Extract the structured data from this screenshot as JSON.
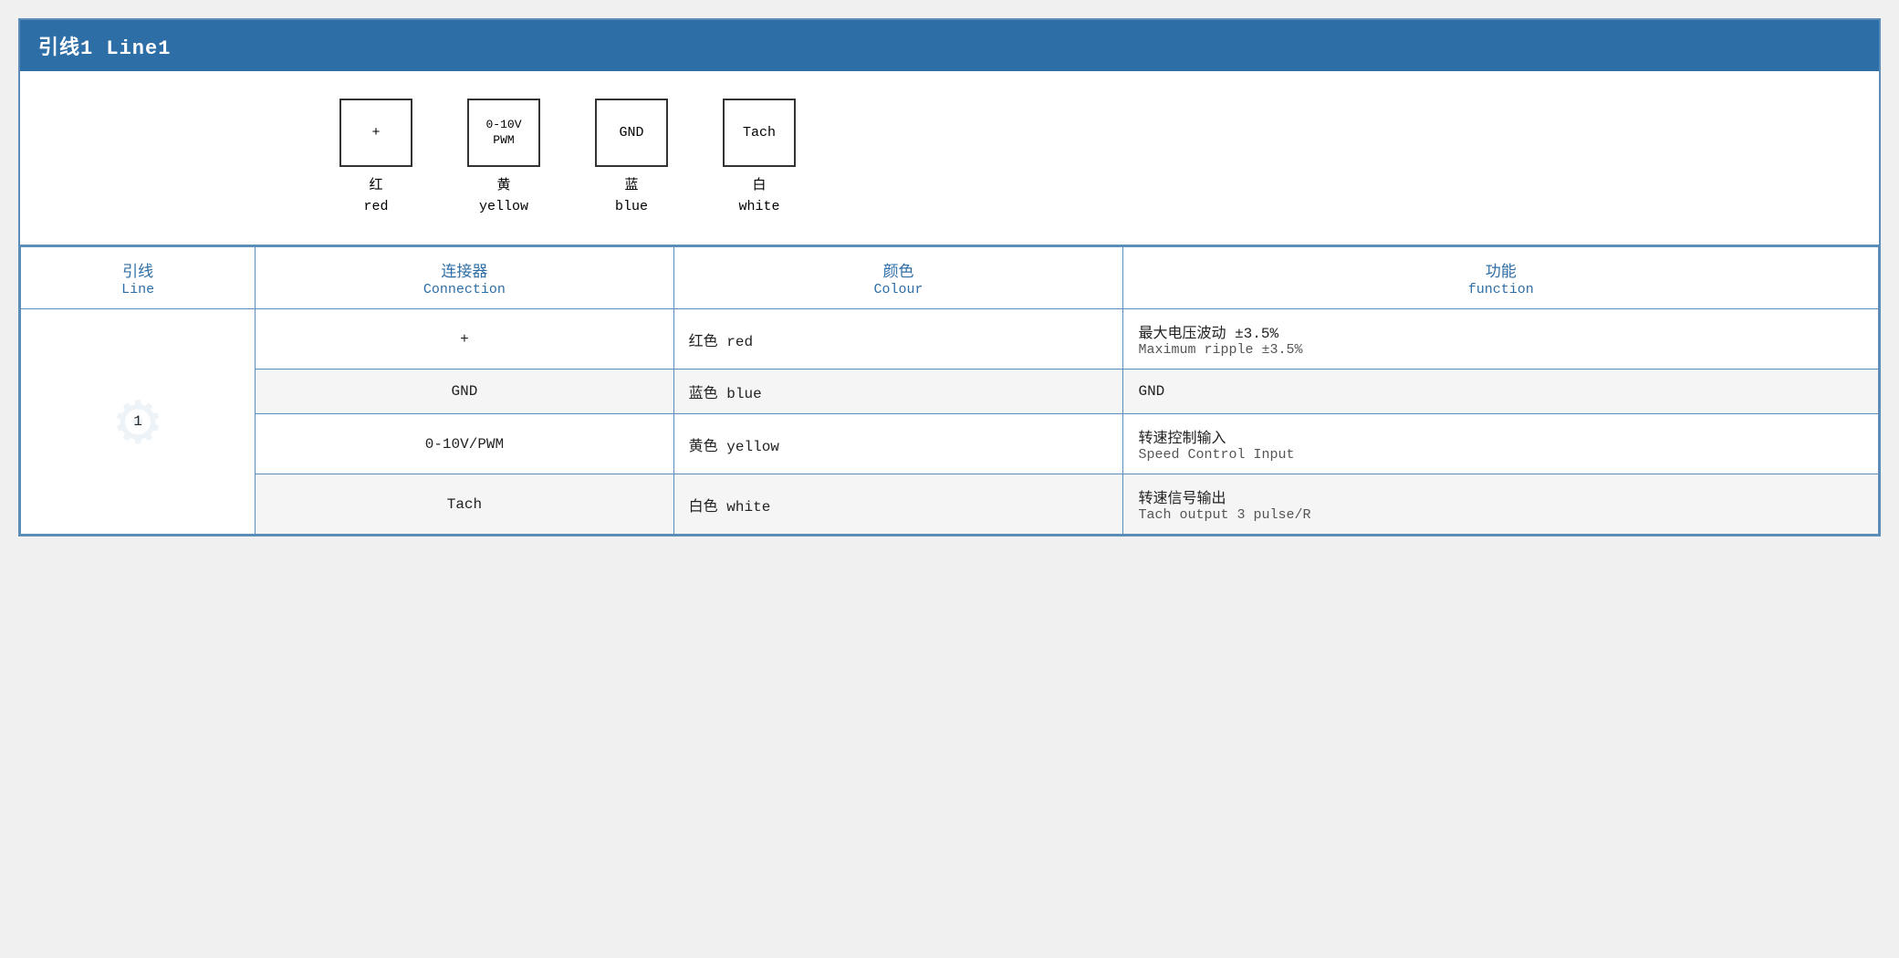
{
  "header": {
    "title": "引线1 Line1"
  },
  "diagram": {
    "connectors": [
      {
        "symbol": "+",
        "label_cn": "红",
        "label_en": "red"
      },
      {
        "symbol": "0-10V\nPWM",
        "label_cn": "黄",
        "label_en": "yellow"
      },
      {
        "symbol": "GND",
        "label_cn": "蓝",
        "label_en": "blue"
      },
      {
        "symbol": "Tach",
        "label_cn": "白",
        "label_en": "white"
      }
    ]
  },
  "table": {
    "headers": [
      {
        "cn": "引线",
        "en": "Line"
      },
      {
        "cn": "连接器",
        "en": "Connection"
      },
      {
        "cn": "颜色",
        "en": "Colour"
      },
      {
        "cn": "功能",
        "en": "function"
      }
    ],
    "rows": [
      {
        "line": "1",
        "rowspan": 4,
        "entries": [
          {
            "connection": "+",
            "colour_cn": "红色",
            "colour_en": "red",
            "function_cn": "最大电压波动 ±3.5%",
            "function_en": "Maximum ripple ±3.5%",
            "shaded": false
          },
          {
            "connection": "GND",
            "colour_cn": "蓝色",
            "colour_en": "blue",
            "function_cn": "GND",
            "function_en": "",
            "shaded": true
          },
          {
            "connection": "0-10V/PWM",
            "colour_cn": "黄色",
            "colour_en": "yellow",
            "function_cn": "转速控制输入",
            "function_en": "Speed Control Input",
            "shaded": false
          },
          {
            "connection": "Tach",
            "colour_cn": "白色",
            "colour_en": "white",
            "function_cn": "转速信号输出",
            "function_en": "Tach output 3 pulse/R",
            "shaded": true
          }
        ]
      }
    ]
  }
}
